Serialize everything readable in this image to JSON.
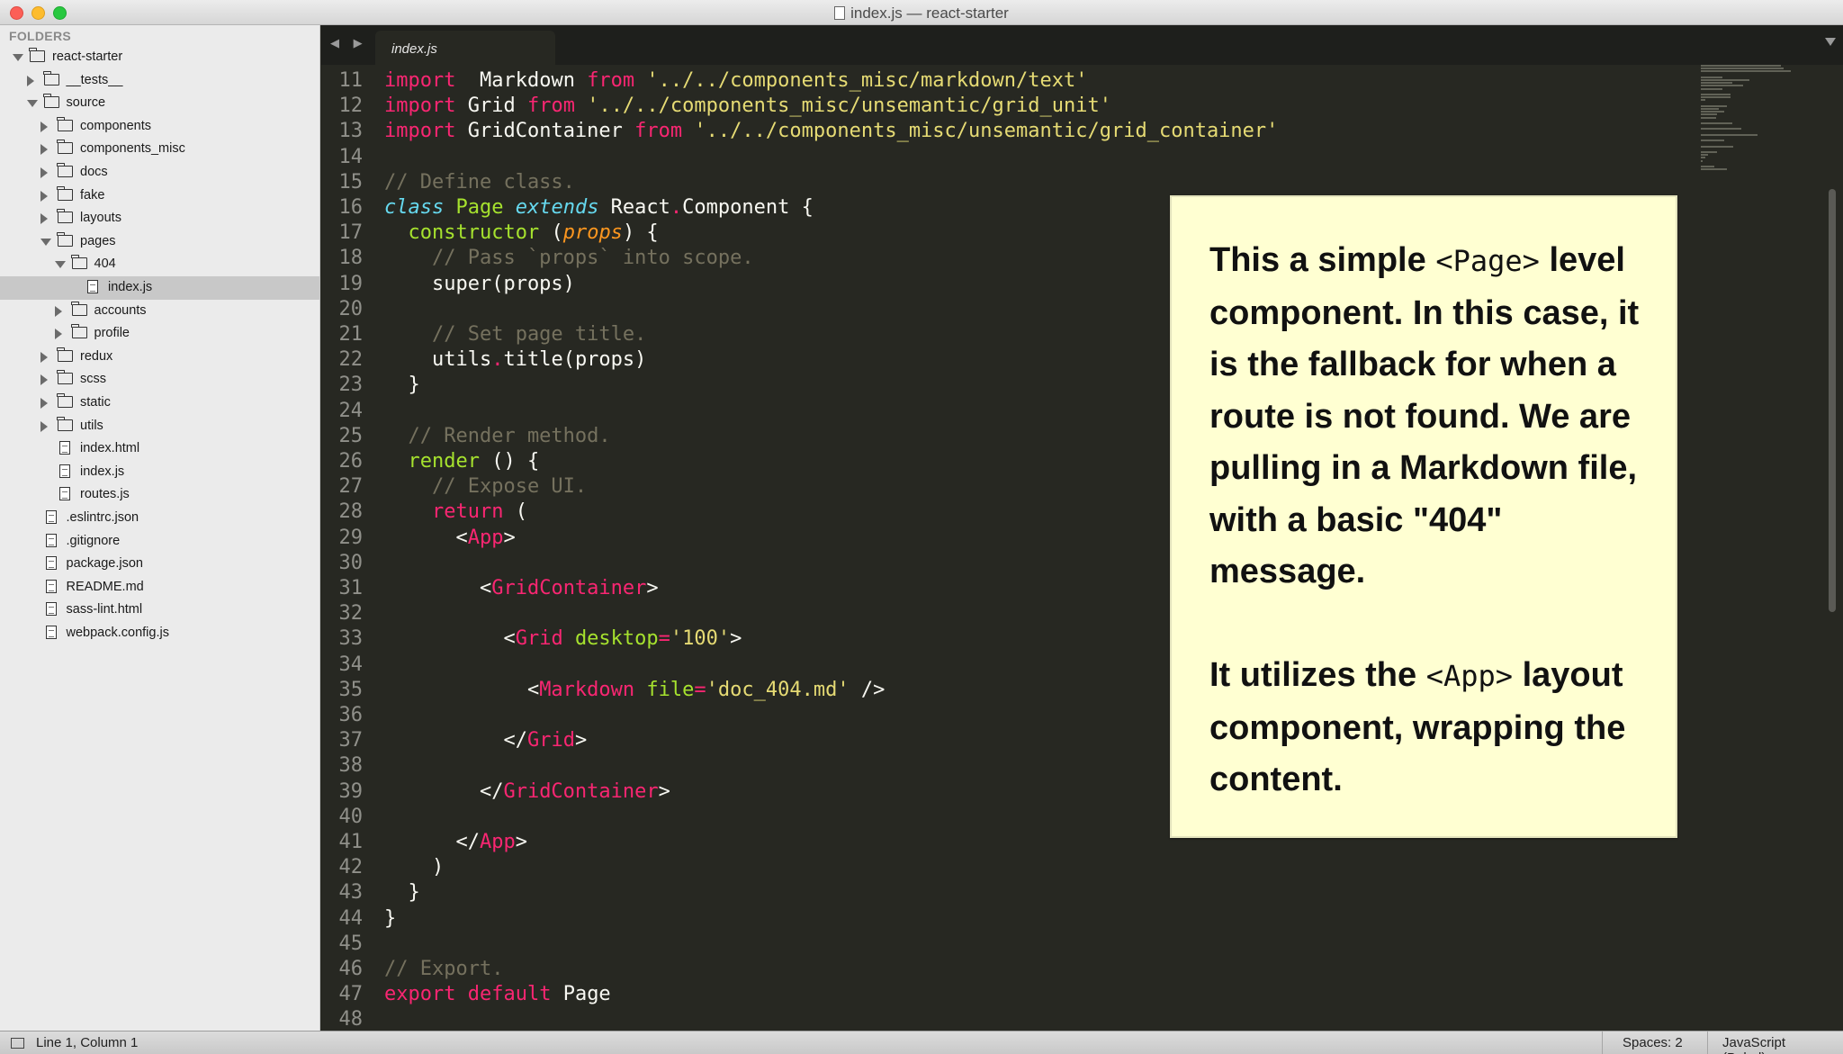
{
  "window": {
    "title": "index.js — react-starter"
  },
  "sidebar": {
    "header": "FOLDERS",
    "items": [
      {
        "label": "react-starter",
        "type": "folder",
        "depth": 0,
        "open": true
      },
      {
        "label": "__tests__",
        "type": "folder",
        "depth": 1,
        "open": false
      },
      {
        "label": "source",
        "type": "folder",
        "depth": 1,
        "open": true
      },
      {
        "label": "components",
        "type": "folder",
        "depth": 2,
        "open": false
      },
      {
        "label": "components_misc",
        "type": "folder",
        "depth": 2,
        "open": false
      },
      {
        "label": "docs",
        "type": "folder",
        "depth": 2,
        "open": false
      },
      {
        "label": "fake",
        "type": "folder",
        "depth": 2,
        "open": false
      },
      {
        "label": "layouts",
        "type": "folder",
        "depth": 2,
        "open": false
      },
      {
        "label": "pages",
        "type": "folder",
        "depth": 2,
        "open": true
      },
      {
        "label": "404",
        "type": "folder",
        "depth": 3,
        "open": true
      },
      {
        "label": "index.js",
        "type": "file",
        "depth": 4,
        "selected": true
      },
      {
        "label": "accounts",
        "type": "folder",
        "depth": 3,
        "open": false
      },
      {
        "label": "profile",
        "type": "folder",
        "depth": 3,
        "open": false
      },
      {
        "label": "redux",
        "type": "folder",
        "depth": 2,
        "open": false
      },
      {
        "label": "scss",
        "type": "folder",
        "depth": 2,
        "open": false
      },
      {
        "label": "static",
        "type": "folder",
        "depth": 2,
        "open": false
      },
      {
        "label": "utils",
        "type": "folder",
        "depth": 2,
        "open": false
      },
      {
        "label": "index.html",
        "type": "file",
        "depth": 2
      },
      {
        "label": "index.js",
        "type": "file",
        "depth": 2
      },
      {
        "label": "routes.js",
        "type": "file",
        "depth": 2
      },
      {
        "label": ".eslintrc.json",
        "type": "file",
        "depth": 1
      },
      {
        "label": ".gitignore",
        "type": "file",
        "depth": 1
      },
      {
        "label": "package.json",
        "type": "file",
        "depth": 1
      },
      {
        "label": "README.md",
        "type": "file",
        "depth": 1
      },
      {
        "label": "sass-lint.html",
        "type": "file",
        "depth": 1
      },
      {
        "label": "webpack.config.js",
        "type": "file",
        "depth": 1
      }
    ]
  },
  "tabs": {
    "nav": "◀ ▶",
    "active_label": "index.js"
  },
  "editor": {
    "lines": [
      {
        "n": "11",
        "tokens": [
          [
            "k",
            "import"
          ],
          [
            "",
            "  Markdown "
          ],
          [
            "k",
            "from"
          ],
          [
            "s",
            " '../../components_misc/markdown/text'"
          ]
        ]
      },
      {
        "n": "12",
        "tokens": [
          [
            "k",
            "import"
          ],
          [
            "",
            " Grid "
          ],
          [
            "k",
            "from"
          ],
          [
            "s",
            " '../../components_misc/unsemantic/grid_unit'"
          ]
        ]
      },
      {
        "n": "13",
        "tokens": [
          [
            "k",
            "import"
          ],
          [
            "",
            " GridContainer "
          ],
          [
            "k",
            "from"
          ],
          [
            "s",
            " '../../components_misc/unsemantic/grid_container'"
          ]
        ]
      },
      {
        "n": "14",
        "tokens": []
      },
      {
        "n": "15",
        "tokens": [
          [
            "c",
            "// Define class."
          ]
        ]
      },
      {
        "n": "16",
        "tokens": [
          [
            "sk",
            "class"
          ],
          [
            "",
            " "
          ],
          [
            "f",
            "Page"
          ],
          [
            "",
            " "
          ],
          [
            "sk",
            "extends"
          ],
          [
            "",
            " React"
          ],
          [
            "k",
            "."
          ],
          [
            "",
            "Component {"
          ]
        ]
      },
      {
        "n": "17",
        "tokens": [
          [
            "",
            "  "
          ],
          [
            "f",
            "constructor"
          ],
          [
            "",
            " ("
          ],
          [
            "p",
            "props"
          ],
          [
            "",
            ") {"
          ]
        ]
      },
      {
        "n": "18",
        "tokens": [
          [
            "c",
            "    // Pass `props` into scope."
          ]
        ]
      },
      {
        "n": "19",
        "tokens": [
          [
            "",
            "    super(props)"
          ]
        ]
      },
      {
        "n": "20",
        "tokens": []
      },
      {
        "n": "21",
        "tokens": [
          [
            "c",
            "    // Set page title."
          ]
        ]
      },
      {
        "n": "22",
        "tokens": [
          [
            "",
            "    utils"
          ],
          [
            "k",
            "."
          ],
          [
            "",
            "title(props)"
          ]
        ]
      },
      {
        "n": "23",
        "tokens": [
          [
            "",
            "  }"
          ]
        ]
      },
      {
        "n": "24",
        "tokens": []
      },
      {
        "n": "25",
        "tokens": [
          [
            "c",
            "  // Render method."
          ]
        ]
      },
      {
        "n": "26",
        "tokens": [
          [
            "",
            "  "
          ],
          [
            "f",
            "render"
          ],
          [
            "",
            " () {"
          ]
        ]
      },
      {
        "n": "27",
        "tokens": [
          [
            "c",
            "    // Expose UI."
          ]
        ]
      },
      {
        "n": "28",
        "tokens": [
          [
            "",
            "    "
          ],
          [
            "k",
            "return"
          ],
          [
            "",
            " ("
          ]
        ]
      },
      {
        "n": "29",
        "tokens": [
          [
            "",
            "      <"
          ],
          [
            "t",
            "App"
          ],
          [
            "",
            ">"
          ]
        ]
      },
      {
        "n": "30",
        "tokens": []
      },
      {
        "n": "31",
        "tokens": [
          [
            "",
            "        <"
          ],
          [
            "t",
            "GridContainer"
          ],
          [
            "",
            ">"
          ]
        ]
      },
      {
        "n": "32",
        "tokens": []
      },
      {
        "n": "33",
        "tokens": [
          [
            "",
            "          <"
          ],
          [
            "t",
            "Grid"
          ],
          [
            "",
            " "
          ],
          [
            "a",
            "desktop"
          ],
          [
            "k",
            "="
          ],
          [
            "s",
            "'100'"
          ],
          [
            "",
            ">"
          ]
        ]
      },
      {
        "n": "34",
        "tokens": []
      },
      {
        "n": "35",
        "tokens": [
          [
            "",
            "            <"
          ],
          [
            "t",
            "Markdown"
          ],
          [
            "",
            " "
          ],
          [
            "a",
            "file"
          ],
          [
            "k",
            "="
          ],
          [
            "s",
            "'doc_404.md'"
          ],
          [
            "",
            " />"
          ]
        ]
      },
      {
        "n": "36",
        "tokens": []
      },
      {
        "n": "37",
        "tokens": [
          [
            "",
            "          </"
          ],
          [
            "t",
            "Grid"
          ],
          [
            "",
            ">"
          ]
        ]
      },
      {
        "n": "38",
        "tokens": []
      },
      {
        "n": "39",
        "tokens": [
          [
            "",
            "        </"
          ],
          [
            "t",
            "GridContainer"
          ],
          [
            "",
            ">"
          ]
        ]
      },
      {
        "n": "40",
        "tokens": []
      },
      {
        "n": "41",
        "tokens": [
          [
            "",
            "      </"
          ],
          [
            "t",
            "App"
          ],
          [
            "",
            ">"
          ]
        ]
      },
      {
        "n": "42",
        "tokens": [
          [
            "",
            "    )"
          ]
        ]
      },
      {
        "n": "43",
        "tokens": [
          [
            "",
            "  }"
          ]
        ]
      },
      {
        "n": "44",
        "tokens": [
          [
            "",
            "}"
          ]
        ]
      },
      {
        "n": "45",
        "tokens": []
      },
      {
        "n": "46",
        "tokens": [
          [
            "c",
            "// Export."
          ]
        ]
      },
      {
        "n": "47",
        "tokens": [
          [
            "k",
            "export"
          ],
          [
            "",
            " "
          ],
          [
            "k",
            "default"
          ],
          [
            "",
            " Page"
          ]
        ]
      },
      {
        "n": "48",
        "tokens": []
      }
    ]
  },
  "callout": {
    "p1_a": "This a simple ",
    "p1_code": "<Page>",
    "p1_b": " level component. In this case, it is the fallback for when a route is not found. We are pulling in a Markdown file, with a basic \"404\" message.",
    "p2_a": "It utilizes the ",
    "p2_code": "<App>",
    "p2_b": " layout component, wrapping the content."
  },
  "statusbar": {
    "position": "Line 1, Column 1",
    "spaces": "Spaces: 2",
    "syntax": "JavaScript (Babel)"
  }
}
